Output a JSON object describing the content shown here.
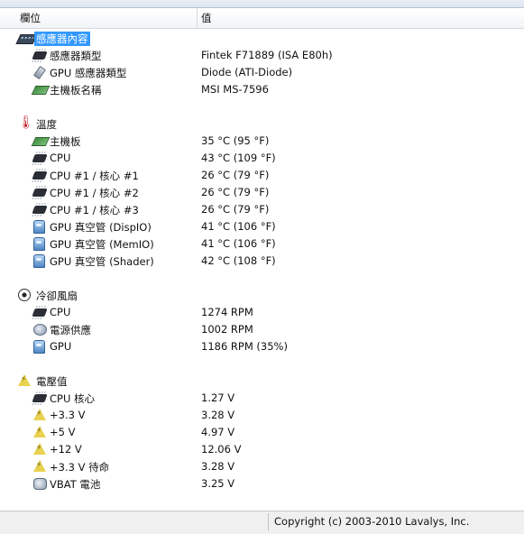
{
  "header": {
    "col_field": "欄位",
    "col_value": "值"
  },
  "sections": [
    {
      "title": "感應器內容",
      "icon": "sensor-board-icon",
      "items": [
        {
          "label": "感應器類型",
          "value": "Fintek F71889  (ISA E80h)",
          "icon": "chip-icon"
        },
        {
          "label": "GPU 感應器類型",
          "value": "Diode  (ATI-Diode)",
          "icon": "probe-icon"
        },
        {
          "label": "主機板名稱",
          "value": "MSI MS-7596",
          "icon": "motherboard-icon"
        }
      ]
    },
    {
      "title": "溫度",
      "icon": "thermometer-icon",
      "items": [
        {
          "label": "主機板",
          "value": "35 °C  (95 °F)",
          "icon": "motherboard-icon"
        },
        {
          "label": "CPU",
          "value": "43 °C  (109 °F)",
          "icon": "cpu-chip-icon"
        },
        {
          "label": "CPU #1 / 核心 #1",
          "value": "26 °C  (79 °F)",
          "icon": "cpu-chip-icon"
        },
        {
          "label": "CPU #1 / 核心 #2",
          "value": "26 °C  (79 °F)",
          "icon": "cpu-chip-icon"
        },
        {
          "label": "CPU #1 / 核心 #3",
          "value": "26 °C  (79 °F)",
          "icon": "cpu-chip-icon"
        },
        {
          "label": "GPU 真空管 (DispIO)",
          "value": "41 °C  (106 °F)",
          "icon": "gpu-icon"
        },
        {
          "label": "GPU 真空管 (MemIO)",
          "value": "41 °C  (106 °F)",
          "icon": "gpu-icon"
        },
        {
          "label": "GPU 真空管 (Shader)",
          "value": "42 °C  (108 °F)",
          "icon": "gpu-icon"
        }
      ]
    },
    {
      "title": "冷卻風扇",
      "icon": "fan-icon",
      "items": [
        {
          "label": "CPU",
          "value": "1274 RPM",
          "icon": "cpu-chip-icon"
        },
        {
          "label": "電源供應",
          "value": "1002 RPM",
          "icon": "power-supply-icon"
        },
        {
          "label": "GPU",
          "value": "1186 RPM  (35%)",
          "icon": "gpu-icon"
        }
      ]
    },
    {
      "title": "電壓值",
      "icon": "voltage-icon",
      "items": [
        {
          "label": "CPU 核心",
          "value": "1.27 V",
          "icon": "cpu-chip-icon"
        },
        {
          "label": "+3.3 V",
          "value": "3.28 V",
          "icon": "voltage-icon"
        },
        {
          "label": "+5 V",
          "value": "4.97 V",
          "icon": "voltage-icon"
        },
        {
          "label": "+12 V",
          "value": "12.06 V",
          "icon": "voltage-icon"
        },
        {
          "label": "+3.3 V 待命",
          "value": "3.28 V",
          "icon": "voltage-icon"
        },
        {
          "label": "VBAT 電池",
          "value": "3.25 V",
          "icon": "battery-icon"
        }
      ]
    }
  ],
  "status": {
    "copyright": "Copyright (c) 2003-2010 Lavalys, Inc."
  },
  "colors": {
    "selection": "#3399ff"
  }
}
